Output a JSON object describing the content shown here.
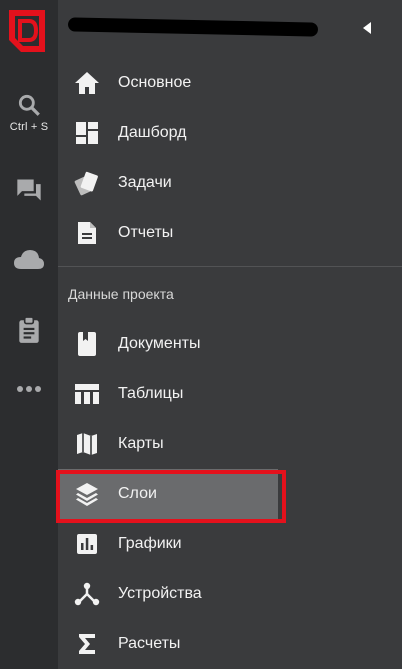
{
  "app": {
    "brand_letter": "D",
    "brand_color": "#e4111c"
  },
  "rail": {
    "search_hint": "Ctrl + S",
    "items": [
      {
        "icon": "search-icon"
      },
      {
        "icon": "chat-icon"
      },
      {
        "icon": "cloud-icon"
      },
      {
        "icon": "clipboard-icon"
      },
      {
        "icon": "more-icon"
      }
    ]
  },
  "header": {
    "collapse_icon": "caret-left-icon"
  },
  "nav": {
    "main": [
      {
        "label": "Основное",
        "icon": "home-icon"
      },
      {
        "label": "Дашборд",
        "icon": "dashboard-icon"
      },
      {
        "label": "Задачи",
        "icon": "tasks-icon"
      },
      {
        "label": "Отчеты",
        "icon": "report-icon"
      }
    ],
    "section_title": "Данные проекта",
    "project": [
      {
        "label": "Документы",
        "icon": "document-icon"
      },
      {
        "label": "Таблицы",
        "icon": "table-icon"
      },
      {
        "label": "Карты",
        "icon": "map-icon"
      },
      {
        "label": "Слои",
        "icon": "layers-icon",
        "active": true
      },
      {
        "label": "Графики",
        "icon": "chart-icon"
      },
      {
        "label": "Устройства",
        "icon": "devices-icon"
      },
      {
        "label": "Расчеты",
        "icon": "sigma-icon"
      }
    ]
  },
  "colors": {
    "rail_bg": "#2c2d2f",
    "panel_bg": "#3a3b3d",
    "active_bg": "#6a6b6d",
    "highlight": "#e4111c"
  }
}
